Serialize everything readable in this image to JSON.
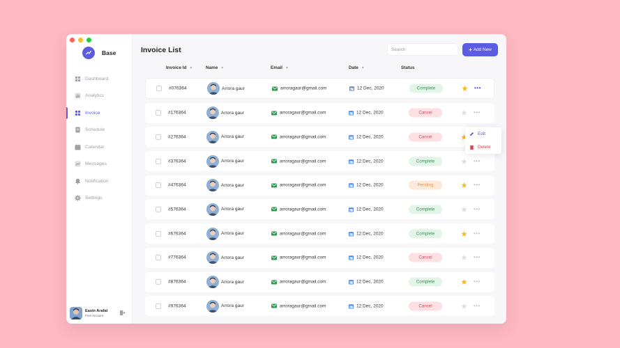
{
  "app": {
    "brand": "Base"
  },
  "sidebar": {
    "items": [
      {
        "label": "Dashboard",
        "icon": "dashboard-icon",
        "active": false
      },
      {
        "label": "Analytics",
        "icon": "analytics-icon",
        "active": false
      },
      {
        "label": "Invoice",
        "icon": "invoice-icon",
        "active": true
      },
      {
        "label": "Schedule",
        "icon": "schedule-icon",
        "active": false
      },
      {
        "label": "Calendar",
        "icon": "calendar-icon",
        "active": false
      },
      {
        "label": "Messages",
        "icon": "messages-icon",
        "active": false
      },
      {
        "label": "Notification",
        "icon": "notification-icon",
        "active": false
      },
      {
        "label": "Settings",
        "icon": "settings-icon",
        "active": false
      }
    ],
    "user": {
      "name": "Easin Arafat",
      "plan": "Free Account"
    }
  },
  "main": {
    "title": "Invoice List",
    "search_placeholder": "Search",
    "add_label": "Add New",
    "columns": [
      "Invoice Id",
      "Name",
      "Email",
      "Date",
      "Status"
    ],
    "rows": [
      {
        "id": "#076364",
        "name": "Arrora gaur",
        "email": "arroragaur@gmail.com",
        "date": "12 Dec, 2020",
        "status": "Complete",
        "starred": true
      },
      {
        "id": "#176364",
        "name": "Arrora gaur",
        "email": "arroragaur@gmail.com",
        "date": "12 Dec, 2020",
        "status": "Cancel",
        "starred": false
      },
      {
        "id": "#276364",
        "name": "Arrora gaur",
        "email": "arroragaur@gmail.com",
        "date": "12 Dec, 2020",
        "status": "Cancel",
        "starred": true
      },
      {
        "id": "#376364",
        "name": "Arrora gaur",
        "email": "arroragaur@gmail.com",
        "date": "12 Dec, 2020",
        "status": "Complete",
        "starred": false
      },
      {
        "id": "#476364",
        "name": "Arrora gaur",
        "email": "arroragaur@gmail.com",
        "date": "12 Dec, 2020",
        "status": "Pending",
        "starred": true
      },
      {
        "id": "#576364",
        "name": "Arrora gaur",
        "email": "arroragaur@gmail.com",
        "date": "12 Dec, 2020",
        "status": "Complete",
        "starred": false
      },
      {
        "id": "#676364",
        "name": "Arrora gaur",
        "email": "arroragaur@gmail.com",
        "date": "12 Dec, 2020",
        "status": "Complete",
        "starred": true
      },
      {
        "id": "#776364",
        "name": "Arrora gaur",
        "email": "arroragaur@gmail.com",
        "date": "12 Dec, 2020",
        "status": "Cancel",
        "starred": false
      },
      {
        "id": "#876364",
        "name": "Arrora gaur",
        "email": "arroragaur@gmail.com",
        "date": "12 Dec, 2020",
        "status": "Complete",
        "starred": true
      },
      {
        "id": "#976364",
        "name": "Arrora gaur",
        "email": "arroragaur@gmail.com",
        "date": "12 Dec, 2020",
        "status": "Cancel",
        "starred": false
      }
    ]
  },
  "menu": {
    "edit": "Edit",
    "delete": "Delete"
  },
  "colors": {
    "background": "#feb8c1",
    "accent": "#5b5ce2",
    "complete": "#3a9152",
    "cancel": "#d84452",
    "pending": "#e8954a",
    "star": "#f5b92a"
  }
}
